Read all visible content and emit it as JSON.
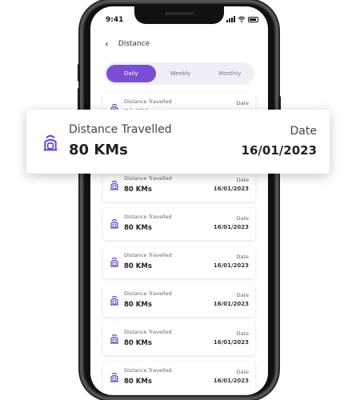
{
  "status": {
    "time": "9:41"
  },
  "nav": {
    "back_icon": "chevron-left-icon",
    "back_symbol": "‹",
    "title": "Distance"
  },
  "tabs": [
    {
      "label": "Daily",
      "active": true
    },
    {
      "label": "Weekly",
      "active": false
    },
    {
      "label": "Monthly",
      "active": false
    }
  ],
  "accent": "#7a4fd6",
  "card_icon": "scooter-icon",
  "cards": [
    {
      "label": "Distance Travelled",
      "value": "80 KMs",
      "date_label": "Date",
      "date": "16/01/2023"
    },
    {
      "label": "Distance Travelled",
      "value": "80 KMs",
      "date_label": "Date",
      "date": "16/01/2023"
    },
    {
      "label": "Distance Travelled",
      "value": "80 KMs",
      "date_label": "Date",
      "date": "16/01/2023"
    },
    {
      "label": "Distance Travelled",
      "value": "80 KMs",
      "date_label": "Date",
      "date": "16/01/2023"
    },
    {
      "label": "Distance Travelled",
      "value": "80 KMs",
      "date_label": "Date",
      "date": "16/01/2023"
    },
    {
      "label": "Distance Travelled",
      "value": "80 KMs",
      "date_label": "Date",
      "date": "16/01/2023"
    },
    {
      "label": "Distance Travelled",
      "value": "80 KMs",
      "date_label": "Date",
      "date": "16/01/2023"
    }
  ],
  "highlight": {
    "label": "Distance Travelled",
    "value": "80 KMs",
    "date_label": "Date",
    "date": "16/01/2023"
  }
}
